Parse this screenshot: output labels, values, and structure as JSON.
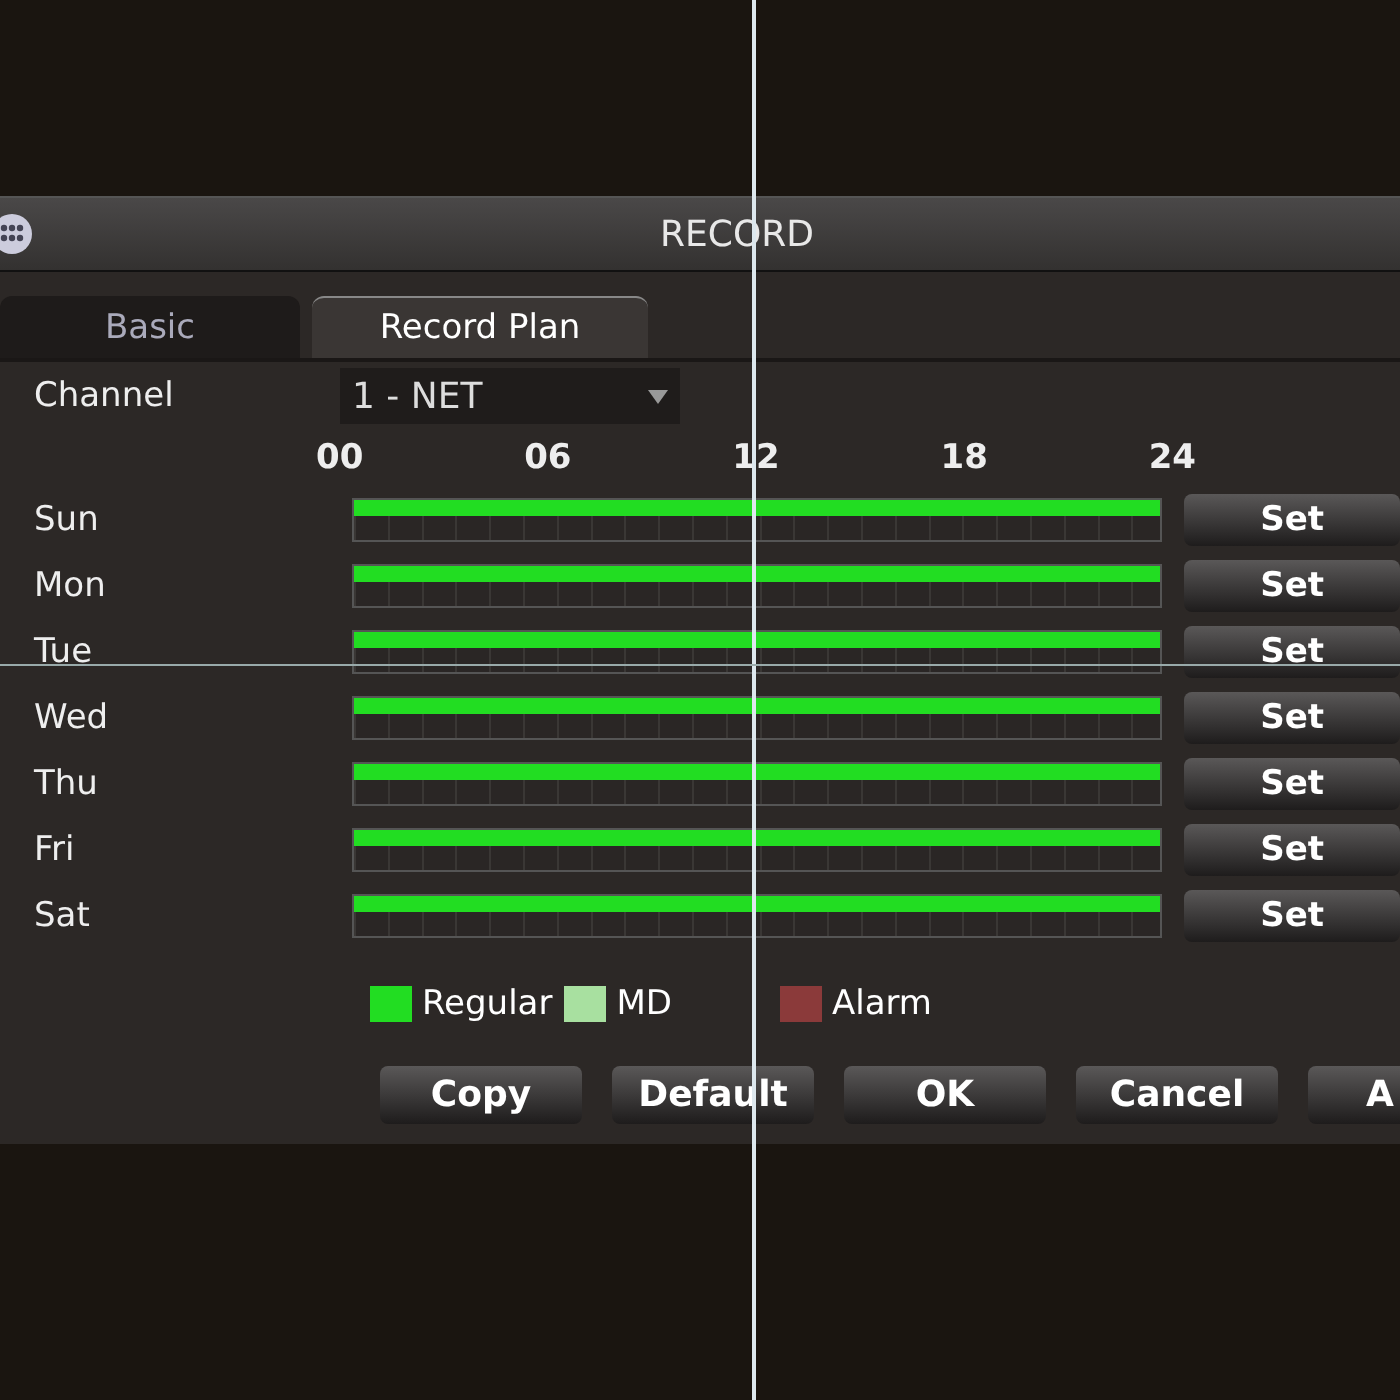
{
  "window": {
    "title": "RECORD"
  },
  "tabs": [
    {
      "label": "Basic",
      "selected": false
    },
    {
      "label": "Record Plan",
      "selected": true
    }
  ],
  "channel": {
    "label": "Channel",
    "value": "1 - NET"
  },
  "hours": [
    "00",
    "06",
    "12",
    "18",
    "24"
  ],
  "days": [
    {
      "name": "Sun",
      "color": "#22dd22",
      "level": 1,
      "button": "Set"
    },
    {
      "name": "Mon",
      "color": "#22dd22",
      "level": 1,
      "button": "Set"
    },
    {
      "name": "Tue",
      "color": "#22dd22",
      "level": 1,
      "button": "Set"
    },
    {
      "name": "Wed",
      "color": "#22dd22",
      "level": 1,
      "button": "Set"
    },
    {
      "name": "Thu",
      "color": "#22dd22",
      "level": 1,
      "button": "Set"
    },
    {
      "name": "Fri",
      "color": "#22dd22",
      "level": 1,
      "button": "Set"
    },
    {
      "name": "Sat",
      "color": "#22dd22",
      "level": 1,
      "button": "Set"
    }
  ],
  "legend": [
    {
      "label": "Regular",
      "color": "#22dd22"
    },
    {
      "label": "MD",
      "color": "#a8e0a0"
    },
    {
      "label": "Alarm",
      "color": "#8b3a3a"
    }
  ],
  "buttons": [
    "Copy",
    "Default",
    "OK",
    "Cancel",
    "A"
  ]
}
